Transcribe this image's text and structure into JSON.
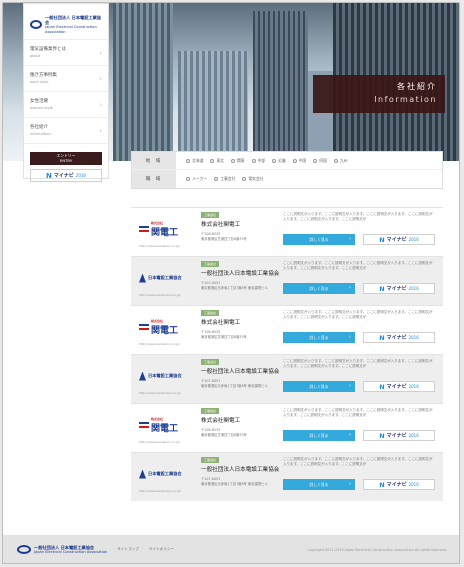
{
  "hero": {
    "title": "各社紹介",
    "subtitle": "Information"
  },
  "logo": {
    "line1": "一般社団法人 日本電設工業協会",
    "line2": "Japan Electrical Construction Association"
  },
  "sidebar": {
    "items": [
      {
        "jp": "電気設備業界とは",
        "en": "about"
      },
      {
        "jp": "働き方事例集",
        "en": "work style"
      },
      {
        "jp": "女性活躍",
        "en": "woman style"
      },
      {
        "jp": "各社紹介",
        "en": "information"
      }
    ],
    "entry_jp": "エントリー",
    "entry_en": "ENTRY",
    "mynavi": "マイナビ",
    "mynavi_year": "2016"
  },
  "filter": {
    "area_label": "地 域",
    "areas": [
      "北海道",
      "東北",
      "関東",
      "中部",
      "近畿",
      "中国",
      "四国",
      "九州"
    ],
    "type_label": "職 域",
    "types": [
      "メーカー",
      "工事会社",
      "電気会社"
    ]
  },
  "companies": [
    {
      "logo": "kandenko",
      "logo_text": "関電工",
      "logo_sub": "株式会社",
      "url": "http://www.kandenko.co.jp/",
      "tag": "工事会社",
      "name": "株式会社関電工",
      "zip": "〒108-8533",
      "addr": "東京都港区芝浦四丁目8番33号",
      "desc": "ここに説明文が入ります。ここに説明文が入ります。ここに説明文が入ります。ここに説明文が入ります。ここに説明文が入ります。ここに説明文が",
      "detail": "詳しく見る",
      "alt": false
    },
    {
      "logo": "jeca",
      "logo_text": "日本電設工業協会",
      "logo_sub": "",
      "url": "http://www.denkoukyo.or.jp/",
      "tag": "工事会社",
      "name": "一般社団法人日本電設工業協会",
      "zip": "〒107-0051",
      "addr": "東京都港区元赤坂1丁目7番8号 東京建物ビル",
      "desc": "ここに説明文が入ります。ここに説明文が入ります。ここに説明文が入ります。ここに説明文が入ります。ここに説明文が入ります。ここに説明文が",
      "detail": "詳しく見る",
      "alt": true
    },
    {
      "logo": "kandenko",
      "logo_text": "関電工",
      "logo_sub": "株式会社",
      "url": "http://www.kandenko.co.jp/",
      "tag": "工事会社",
      "name": "株式会社関電工",
      "zip": "〒108-8533",
      "addr": "東京都港区芝浦四丁目8番33号",
      "desc": "ここに説明文が入ります。ここに説明文が入ります。ここに説明文が入ります。ここに説明文が入ります。ここに説明文が入ります。ここに説明文が",
      "detail": "詳しく見る",
      "alt": false
    },
    {
      "logo": "jeca",
      "logo_text": "日本電設工業協会",
      "logo_sub": "",
      "url": "http://www.denkoukyo.or.jp/",
      "tag": "工事会社",
      "name": "一般社団法人日本電設工業協会",
      "zip": "〒107-0051",
      "addr": "東京都港区元赤坂1丁目7番8号 東京建物ビル",
      "desc": "ここに説明文が入ります。ここに説明文が入ります。ここに説明文が入ります。ここに説明文が入ります。ここに説明文が入ります。ここに説明文が",
      "detail": "詳しく見る",
      "alt": true
    },
    {
      "logo": "kandenko",
      "logo_text": "関電工",
      "logo_sub": "株式会社",
      "url": "http://www.kandenko.co.jp/",
      "tag": "工事会社",
      "name": "株式会社関電工",
      "zip": "〒108-8533",
      "addr": "東京都港区芝浦四丁目8番33号",
      "desc": "ここに説明文が入ります。ここに説明文が入ります。ここに説明文が入ります。ここに説明文が入ります。ここに説明文が入ります。ここに説明文が",
      "detail": "詳しく見る",
      "alt": false
    },
    {
      "logo": "jeca",
      "logo_text": "日本電設工業協会",
      "logo_sub": "",
      "url": "http://www.denkoukyo.or.jp/",
      "tag": "工事会社",
      "name": "一般社団法人日本電設工業協会",
      "zip": "〒107-0051",
      "addr": "東京都港区元赤坂1丁目7番8号 東京建物ビル",
      "desc": "ここに説明文が入ります。ここに説明文が入ります。ここに説明文が入ります。ここに説明文が入ります。ここに説明文が入ります。ここに説明文が",
      "detail": "詳しく見る",
      "alt": true
    }
  ],
  "footer": {
    "links": [
      "サイトマップ",
      "サイトポリシー"
    ],
    "copyright": "Copyright 2011-2015 Japan Electrical Construction Association All rights reserved."
  },
  "colors": {
    "accent_blue": "#33a9dc",
    "hero_panel": "#3a1616",
    "tag_green": "#8db174",
    "brand_navy": "#1f3f94",
    "brand_red": "#d3191c"
  }
}
